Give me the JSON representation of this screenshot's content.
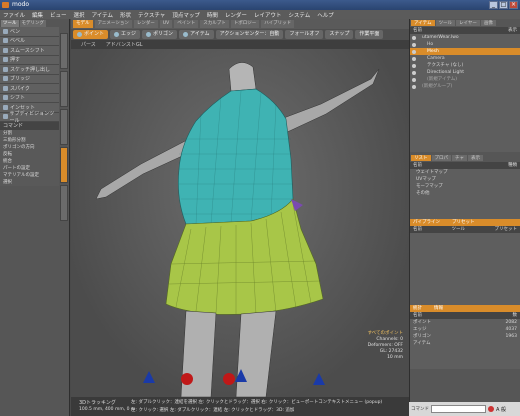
{
  "window": {
    "title": "modo",
    "buttons": [
      "_",
      "□",
      "×"
    ]
  },
  "menu": [
    "ファイル",
    "編集",
    "ビュー",
    "選択",
    "アイテム",
    "形状",
    "テクスチャ",
    "頂点マップ",
    "時間",
    "レンダー",
    "レイアウト",
    "システム",
    "ヘルプ"
  ],
  "left_panel": {
    "tabs": [
      "ツール",
      "モデリング"
    ],
    "tools": [
      {
        "label": "ベン",
        "icon": "pen-icon"
      },
      {
        "label": "ベベル",
        "icon": "bevel-icon"
      },
      {
        "label": "スムースシフト",
        "icon": "smooth-shift-icon"
      },
      {
        "label": "押す",
        "icon": "push-icon"
      },
      {
        "label": "スケッチ押し出し",
        "icon": "sketch-extrude-icon"
      },
      {
        "label": "ブリッジ",
        "icon": "bridge-icon"
      },
      {
        "label": "スパイク",
        "icon": "spike-icon"
      },
      {
        "label": "シフト",
        "icon": "shift-icon"
      },
      {
        "label": "インセット",
        "icon": "inset-icon"
      },
      {
        "label": "サブディビジョンツール",
        "icon": "subdivision-icon"
      }
    ],
    "command_header": "コマンド",
    "commands": [
      "分割",
      "三角形分割",
      "ポリゴンの方向",
      "反転",
      "統合",
      "パートの設定",
      "マテリアルの設定",
      "選択"
    ]
  },
  "toolbar": {
    "tabs": [
      "モデル",
      "アニメーション",
      "レンダー",
      "UV",
      "ペイント",
      "スカルプト",
      "トポロジー",
      "ハイブリッド"
    ]
  },
  "modebar": {
    "modes": [
      {
        "label": "ポイント",
        "active": true
      },
      {
        "label": "エッジ",
        "active": false
      },
      {
        "label": "ポリゴン",
        "active": false
      },
      {
        "label": "アイテム",
        "active": false
      }
    ],
    "options": [
      "アクションセンター：自動",
      "フォールオフ",
      "スナップ",
      "作業平面"
    ]
  },
  "view_header": {
    "items": [
      "パース",
      "アドバンストGL"
    ]
  },
  "viewport_info": {
    "title": "すべてのポイント",
    "lines": [
      "Channels: 0",
      "Deformers: OFF",
      "GL: 27432",
      "10 mm"
    ]
  },
  "status": {
    "title": "3Dトラッキング",
    "coords": "100.5 mm, 400 mm, 0 m",
    "hint1": "左: ダブルクリック：連結を選択 左: クリックとドラッグ：選択 右: クリック：ビューポートコンテキストメニュー (popup)",
    "hint2": "左: クリック: 選択 左: ダブルクリック：連結 左: クリックとドラッグ：3D: 追加"
  },
  "right_panel": {
    "top_tabs": [
      "アイテム",
      "ツール",
      "レイヤー",
      "画像"
    ],
    "tree_header": [
      "名前",
      "表示"
    ],
    "tree": [
      {
        "label": "utamerWear.lwo",
        "indent": 1,
        "selected": false
      },
      {
        "label": "Ho",
        "indent": 2,
        "selected": false
      },
      {
        "label": "Mesh",
        "indent": 2,
        "selected": true
      },
      {
        "label": "Camera",
        "indent": 2,
        "selected": false
      },
      {
        "label": "テクスチャ (なし)",
        "indent": 2,
        "selected": false
      },
      {
        "label": "Directional Light",
        "indent": 2,
        "selected": false
      },
      {
        "label": "(新規アイテム)",
        "indent": 2,
        "selected": false
      },
      {
        "label": "(新規グループ)",
        "indent": 1,
        "selected": false
      }
    ],
    "list_tabs": [
      "リスト",
      "プロパ",
      "チャ",
      "表示"
    ],
    "list_header": [
      "名前",
      "種類"
    ],
    "list_items": [
      "ウェイトマップ",
      "UVマップ",
      "モーフマップ",
      "その他"
    ],
    "shader_tabs": [
      "パイプライン",
      "プリセット"
    ],
    "shader_header": [
      "名前",
      "ツール",
      "プリセット"
    ],
    "stats_tabs": [
      "統計",
      "情報"
    ],
    "stats_header": [
      "名前",
      "数"
    ],
    "stats": [
      {
        "label": "ポイント",
        "count": "2082"
      },
      {
        "label": "エッジ",
        "count": "4037"
      },
      {
        "label": "ポリゴン",
        "count": "1963"
      },
      {
        "label": "アイテム",
        "count": ""
      }
    ]
  },
  "command_bar": {
    "label": "コマンド",
    "tray": "A 般"
  },
  "colors": {
    "accent": "#d98c2a",
    "top": "#3fb3b3",
    "skirt": "#a8c648",
    "body": "#b5b5b5"
  }
}
